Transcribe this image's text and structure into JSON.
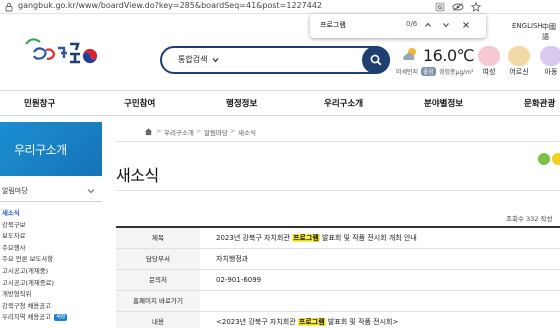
{
  "browser": {
    "url": "gangbuk.go.kr/www/boardView.do?key=285&boardSeq=41&post=1227442"
  },
  "findbar": {
    "query": "프로그램",
    "count": "0/6"
  },
  "toplinks": {
    "english": "ENGLISH",
    "chinese": "中國語"
  },
  "header": {
    "search_label": "통합검색",
    "temperature": "16.0℃",
    "dust_label": "미세먼지",
    "dust_status": "좋음",
    "dust_value": "경험종μg/m³",
    "quick": [
      {
        "label": "여성",
        "color": "#f6c9d2"
      },
      {
        "label": "어르신",
        "color": "#f3d9a6"
      },
      {
        "label": "아동",
        "color": "#d9c8ef"
      }
    ]
  },
  "gnb": [
    "민원창구",
    "구민참여",
    "행정정보",
    "우리구소개",
    "분야별정보",
    "문화관광"
  ],
  "sidebar": {
    "title": "우리구소개",
    "section": "알림마당",
    "items": [
      {
        "label": "새소식",
        "active": true
      },
      {
        "label": "강북구보",
        "active": false
      },
      {
        "label": "보도자료",
        "active": false
      },
      {
        "label": "주요행사",
        "active": false
      },
      {
        "label": "주요 언론 보도사항",
        "active": false
      },
      {
        "label": "고시공고(게재중)",
        "active": false
      },
      {
        "label": "고시공고(게재종료)",
        "active": false
      },
      {
        "label": "개방형직위",
        "active": false
      },
      {
        "label": "강북구청 채용공고",
        "active": false
      },
      {
        "label": "우리지역 채용공고",
        "active": false,
        "badge": "새창"
      }
    ]
  },
  "breadcrumb": [
    "우리구소개",
    "알림마당",
    "새소식"
  ],
  "page": {
    "title": "새소식",
    "views": "조회수 332 작성"
  },
  "table": {
    "rows": [
      {
        "label": "제목",
        "pre": "2023년 강북구 자치회관 ",
        "hl": "프로그램",
        "post": " 발표회 및 작품 전시회 개최 안내"
      },
      {
        "label": "담당부서",
        "pre": "자치행정과",
        "hl": "",
        "post": ""
      },
      {
        "label": "문의처",
        "pre": "02-901-6099",
        "hl": "",
        "post": ""
      },
      {
        "label": "홈페이지 바로가기",
        "pre": "",
        "hl": "",
        "post": ""
      },
      {
        "label": "내용",
        "pre": "<2023년 강북구 자치회관 ",
        "hl": "프로그램",
        "post": " 발표회 및 작품 전시회>"
      }
    ]
  },
  "colors": {
    "navy": "#1f3f73",
    "side_blue": "#1a8fd0",
    "highlight": "#ffee44"
  }
}
